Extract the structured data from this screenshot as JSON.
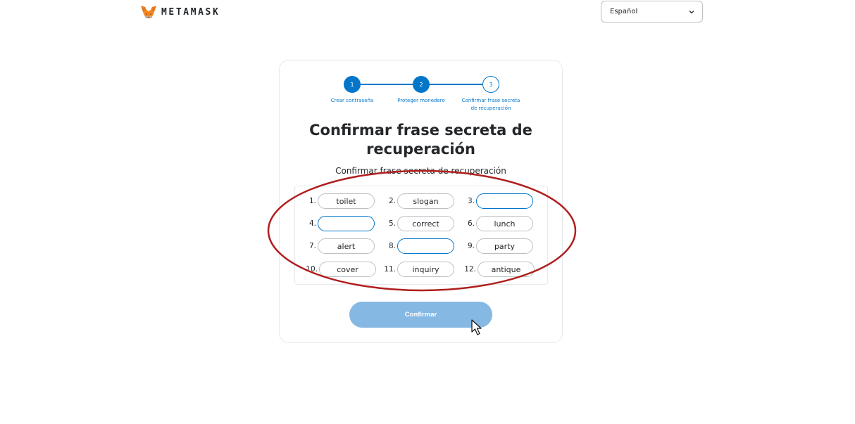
{
  "header": {
    "brand": "METAMASK",
    "language": {
      "selected": "Español"
    }
  },
  "stepper": {
    "steps": [
      {
        "number": "1",
        "label": "Crear contraseña",
        "state": "done"
      },
      {
        "number": "2",
        "label": "Proteger monedero",
        "state": "done"
      },
      {
        "number": "3",
        "label_line1": "Confirmar frase secreta",
        "label_line2": "de recuperación",
        "state": "current"
      }
    ]
  },
  "main": {
    "title_line1": "Confirmar frase secreta de",
    "title_line2": "recuperación",
    "subtitle": "Confirmar frase secreta de recuperación",
    "words": [
      {
        "index": "1.",
        "value": "toilet",
        "editable": false
      },
      {
        "index": "2.",
        "value": "slogan",
        "editable": false
      },
      {
        "index": "3.",
        "value": "",
        "editable": true
      },
      {
        "index": "4.",
        "value": "",
        "editable": true
      },
      {
        "index": "5.",
        "value": "correct",
        "editable": false
      },
      {
        "index": "6.",
        "value": "lunch",
        "editable": false
      },
      {
        "index": "7.",
        "value": "alert",
        "editable": false
      },
      {
        "index": "8.",
        "value": "",
        "editable": true
      },
      {
        "index": "9.",
        "value": "party",
        "editable": false
      },
      {
        "index": "10.",
        "value": "cover",
        "editable": false
      },
      {
        "index": "11.",
        "value": "inquiry",
        "editable": false
      },
      {
        "index": "12.",
        "value": "antique",
        "editable": false
      }
    ],
    "confirm_label": "Confirmar"
  },
  "colors": {
    "accent": "#0376c9",
    "button_disabled": "#86b8e4",
    "annotation": "#b01e1e"
  },
  "icons": {
    "logo": "metamask-fox-icon",
    "dropdown": "chevron-down-icon",
    "cursor": "mouse-pointer-icon"
  }
}
